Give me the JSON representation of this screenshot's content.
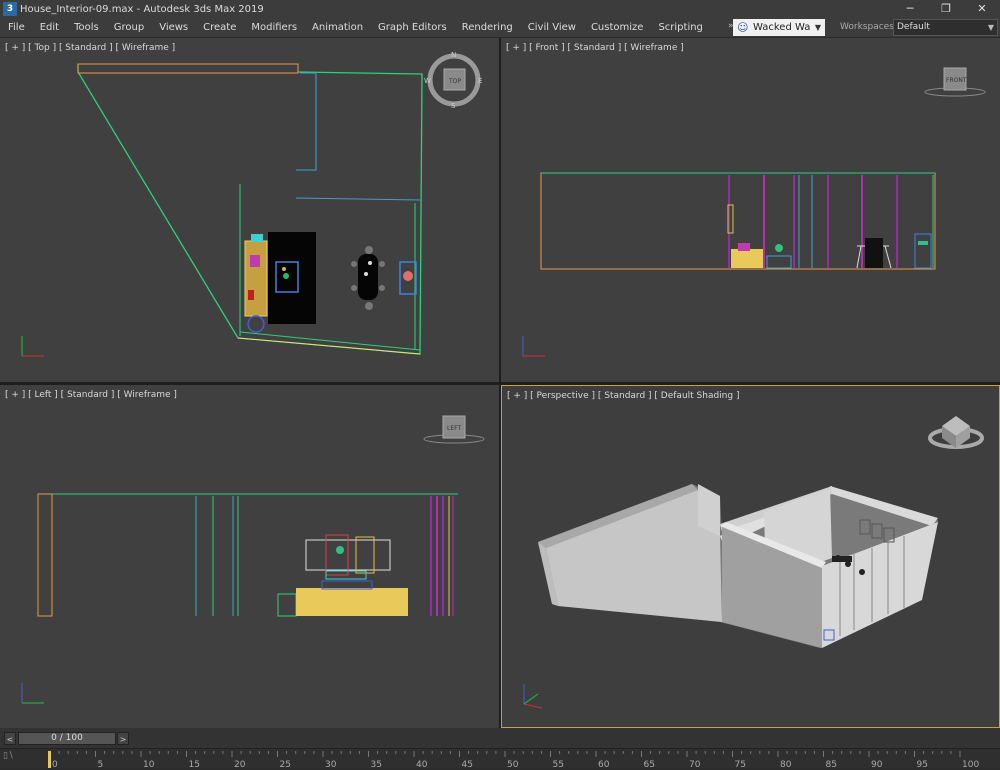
{
  "titlebar": {
    "icon": "3ds-max-icon",
    "title": "House_Interior-09.max - Autodesk 3ds Max 2019",
    "minimize": "─",
    "restore": "❐",
    "close": "✕"
  },
  "menu": {
    "items": [
      {
        "label": "File"
      },
      {
        "label": "Edit"
      },
      {
        "label": "Tools"
      },
      {
        "label": "Group"
      },
      {
        "label": "Views"
      },
      {
        "label": "Create"
      },
      {
        "label": "Modifiers"
      },
      {
        "label": "Animation"
      },
      {
        "label": "Graph Editors"
      },
      {
        "label": "Rendering"
      },
      {
        "label": "Civil View"
      },
      {
        "label": "Customize"
      },
      {
        "label": "Scripting"
      }
    ],
    "overflow": "»",
    "user": "Wacked Wa",
    "workspaces_label": "Workspaces:",
    "workspace_value": "Default"
  },
  "viewports": {
    "top": {
      "label": "[ + ] [ Top ] [ Standard ] [ Wireframe ]"
    },
    "front": {
      "label": "[ + ] [ Front ] [ Standard ] [ Wireframe ]"
    },
    "left": {
      "label": "[ + ] [ Left ] [ Standard ] [ Wireframe ]"
    },
    "perspective": {
      "label": "[ + ] [ Perspective ] [ Standard ] [ Default Shading ]"
    }
  },
  "viewcube": {
    "top_face": "TOP",
    "front_face": "FRONT",
    "left_face": "LEFT",
    "compass_n": "N",
    "compass_s": "S",
    "compass_e": "E",
    "compass_w": "W"
  },
  "timeline": {
    "frame_display": "0 / 100",
    "prev": "<",
    "next": ">",
    "ticks": [
      "0",
      "5",
      "10",
      "15",
      "20",
      "25",
      "30",
      "35",
      "40",
      "45",
      "50",
      "55",
      "60",
      "65",
      "70",
      "75",
      "80",
      "85",
      "90",
      "95",
      "100"
    ],
    "track_icon": "track-icon"
  },
  "colors": {
    "wall_line": "#2ed07a",
    "accent_yellow": "#e8c95a",
    "selection_border": "#c9a33a"
  }
}
